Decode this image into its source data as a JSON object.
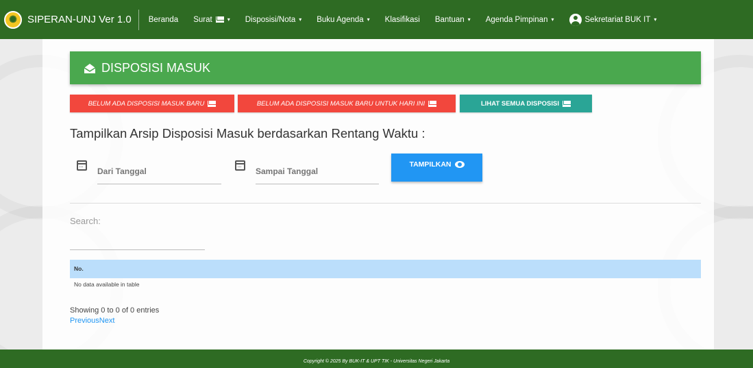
{
  "navbar": {
    "brand": "SIPERAN-UNJ Ver 1.0",
    "items": [
      {
        "label": "Beranda",
        "has_caret": false
      },
      {
        "label": "Surat",
        "has_caret": true,
        "icon": "mail-icon"
      },
      {
        "label": "Disposisi/Nota",
        "has_caret": true
      },
      {
        "label": "Buku Agenda",
        "has_caret": true
      },
      {
        "label": "Klasifikasi",
        "has_caret": false
      },
      {
        "label": "Bantuan",
        "has_caret": true
      },
      {
        "label": "Agenda Pimpinan",
        "has_caret": true
      }
    ],
    "user": "Sekretariat BUK IT",
    "caret": "▾",
    "bg_color": "#2e6b23"
  },
  "header": {
    "title": "DISPOSISI MASUK",
    "icon": "envelope-open-icon",
    "bg_color": "#4aa84e"
  },
  "buttons": {
    "new_disposition": "BELUM ADA DISPOSISI MASUK BARU",
    "new_today": "BELUM ADA DISPOSISI MASUK BARU UNTUK HARI INI",
    "view_all": "LIHAT SEMUA DISPOSISI",
    "red_color": "#f2473d",
    "teal_color": "#2aa596"
  },
  "range": {
    "title": "Tampilkan Arsip Disposisi Masuk berdasarkan Rentang Waktu :",
    "from_placeholder": "Dari Tanggal",
    "to_placeholder": "Sampai Tanggal",
    "submit_label": "TAMPILKAN",
    "submit_color": "#2196f3"
  },
  "table": {
    "search_label": "Search:",
    "columns": [
      "No."
    ],
    "empty_message": "No data available in table",
    "info": "Showing 0 to 0 of 0 entries",
    "previous": "Previous",
    "next": "Next",
    "header_color": "#bbdefb"
  },
  "footer": {
    "text": "Copyright © 2025 By BUK-IT & UPT TIK - Universitas Negeri Jakarta"
  }
}
